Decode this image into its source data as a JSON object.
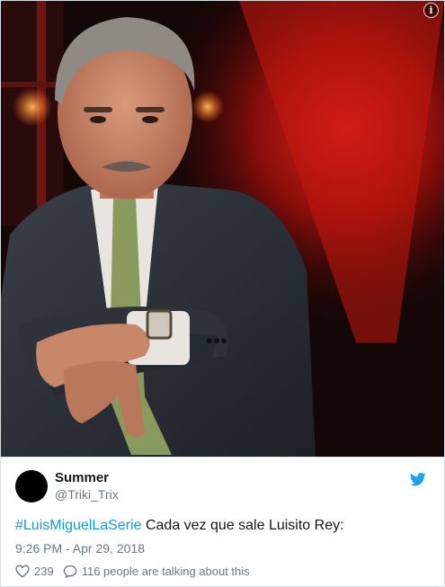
{
  "media": {
    "description_icon": "info-icon",
    "info_label": "i"
  },
  "tweet": {
    "author": {
      "display_name": "Summer",
      "handle": "@Triki_Trix",
      "avatar_color": "#000000"
    },
    "text": {
      "hashtag": "#LuisMiguelLaSerie",
      "body": " Cada vez que sale Luisito Rey:"
    },
    "timestamp": "9:26 PM - Apr 29, 2018",
    "likes": "239",
    "conversation": "116 people are talking about this",
    "brand_icon": "twitter-bird-icon",
    "colors": {
      "link": "#1b95e0",
      "text": "#14171a",
      "muted": "#657786",
      "brand": "#1da1f2"
    }
  }
}
